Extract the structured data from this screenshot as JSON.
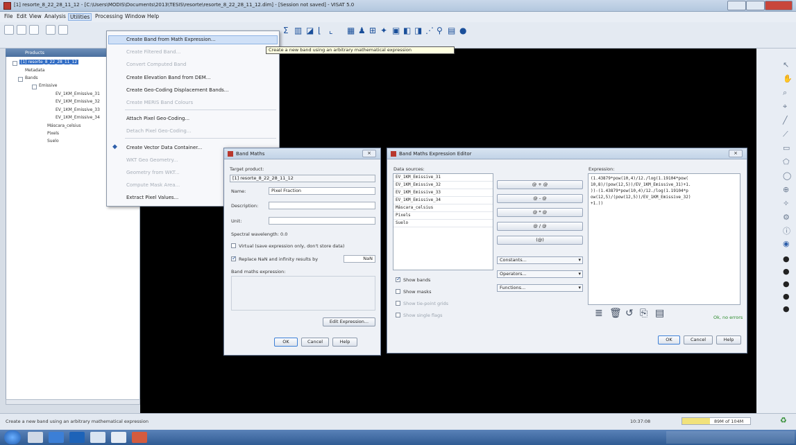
{
  "window": {
    "title": "[1] resorte_8_22_28_11_12 - [C:\\Users\\MODIS\\Documents\\2013\\TESIS\\resorte\\resorte_8_22_28_11_12.dim] - [Session not saved] - VISAT 5.0"
  },
  "menubar": [
    "File",
    "Edit",
    "View",
    "Analysis",
    "Utilities",
    "Processing",
    "Window",
    "Help"
  ],
  "toolbar": {
    "icons": [
      "new-icon",
      "open-icon",
      "save-icon",
      "sigma-icon",
      "chart-icon",
      "zoom-icon",
      "help-icon"
    ]
  },
  "tree": {
    "header": "Products",
    "rows": [
      "[1] resorte_8_22_28_11_12",
      "Metadata",
      "Bands",
      "Emissive",
      "EV_1KM_Emissive_31",
      "EV_1KM_Emissive_32",
      "EV_1KM_Emissive_33",
      "EV_1KM_Emissive_34",
      "Máscara_celsius",
      "Pixels",
      "Suelo"
    ]
  },
  "dropdown": {
    "items": [
      {
        "label": "Create Band from Math Expression...",
        "enabled": true
      },
      {
        "label": "Create Filtered Band...",
        "enabled": false
      },
      {
        "label": "Convert Computed Band",
        "enabled": false
      },
      {
        "label": "Create Elevation Band from DEM...",
        "enabled": true
      },
      {
        "label": "Create Geo-Coding Displacement Bands...",
        "enabled": true
      },
      {
        "label": "Create MERIS Band Colours",
        "enabled": false
      },
      {
        "label": "Attach Pixel Geo-Coding...",
        "enabled": true
      },
      {
        "label": "Detach Pixel Geo-Coding...",
        "enabled": false
      },
      {
        "label": "Create Vector Data Container...",
        "enabled": true
      },
      {
        "label": "WKT Geo Geometry...",
        "enabled": false
      },
      {
        "label": "Geometry from WKT...",
        "enabled": false
      },
      {
        "label": "Compute Mask Area...",
        "enabled": false
      },
      {
        "label": "Extract Pixel Values...",
        "enabled": true
      }
    ]
  },
  "tooltip": "Create a new band using an arbitrary mathematical expression",
  "bandmath": {
    "title": "Band Maths",
    "target_product_label": "Target product:",
    "target_product_value": "[1] resorte_8_22_28_11_12",
    "name_label": "Name:",
    "name_value": "Pixel Fraction",
    "description_label": "Description:",
    "unit_label": "Unit:",
    "wavelength_label": "Spectral wavelength: 0.0",
    "virtual_label": "Virtual (save expression only, don't store data)",
    "replace_label": "Replace NaN and infinity results by",
    "replace_value": "NaN",
    "expr_label": "Band maths expression:",
    "edit_button": "Edit Expression...",
    "ok": "OK",
    "cancel": "Cancel",
    "help": "Help"
  },
  "editor": {
    "title": "Band Maths Expression Editor",
    "sources_label": "Data sources:",
    "sources": [
      "EV_1KM_Emissive_31",
      "EV_1KM_Emissive_32",
      "EV_1KM_Emissive_33",
      "EV_1KM_Emissive_34",
      "Máscara_celsius",
      "Pixels",
      "Suelo"
    ],
    "ops": [
      "@ + @",
      "@ - @",
      "@ * @",
      "@ / @",
      "(@)"
    ],
    "combos": [
      "Constants...",
      "Operators...",
      "Functions..."
    ],
    "show_bands": "Show bands",
    "show_masks": "Show masks",
    "show_tie": "Show tie-point grids",
    "show_flags": "Show single flags",
    "expression_label": "Expression:",
    "expression": "(1.43879*pow(10,4)/12./log(1.19104*pow(\n10,8)/(pow(12,5))/EV_1KM_Emissive_31)+1.\n))-(1.43879*pow(10,4)/12./log(1.19104*p\now(12,5)/(pow(12,5))/EV_1KM_Emissive_32)\n+1.))",
    "status": "Ok, no errors",
    "ok": "OK",
    "cancel": "Cancel",
    "help": "Help"
  },
  "statusbar": {
    "message": "Create a new band using an arbitrary mathematical expression",
    "coords": "10:37:08",
    "memory": "89M of 104M"
  }
}
